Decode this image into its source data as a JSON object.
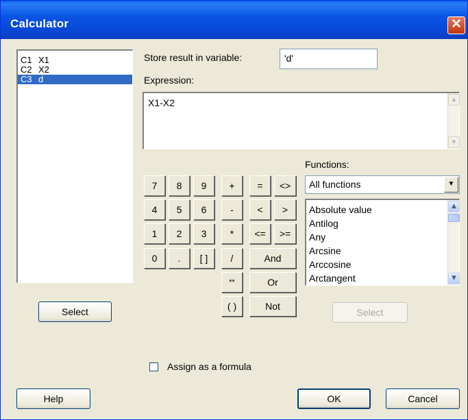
{
  "window": {
    "title": "Calculator",
    "close_glyph": "✕"
  },
  "variables": [
    {
      "col": "C1",
      "name": "X1",
      "selected": false
    },
    {
      "col": "C2",
      "name": "X2",
      "selected": false
    },
    {
      "col": "C3",
      "name": "d",
      "selected": true
    }
  ],
  "left_select_label": "Select",
  "store": {
    "label": "Store result in variable:",
    "value": "'d'"
  },
  "expression": {
    "label": "Expression:",
    "value": "X1-X2"
  },
  "keypad": {
    "k7": "7",
    "k8": "8",
    "k9": "9",
    "k4": "4",
    "k5": "5",
    "k6": "6",
    "k1": "1",
    "k2": "2",
    "k3": "3",
    "k0": "0",
    "kdot": ".",
    "kbrackets": "[ ]",
    "plus": "+",
    "minus": "-",
    "times": "*",
    "divide": "/",
    "power": "**",
    "parens": "( )",
    "eq": "=",
    "ne": "<>",
    "lt": "<",
    "gt": ">",
    "le": "<=",
    "ge": ">=",
    "and": "And",
    "or": "Or",
    "not": "Not"
  },
  "functions": {
    "label": "Functions:",
    "selected": "All functions",
    "items": [
      "Absolute value",
      "Antilog",
      "Any",
      "Arcsine",
      "Arccosine",
      "Arctangent"
    ]
  },
  "functions_select_label": "Select",
  "assign_formula": {
    "label": "Assign as a formula",
    "checked": false
  },
  "footer": {
    "help": "Help",
    "ok": "OK",
    "cancel": "Cancel"
  }
}
